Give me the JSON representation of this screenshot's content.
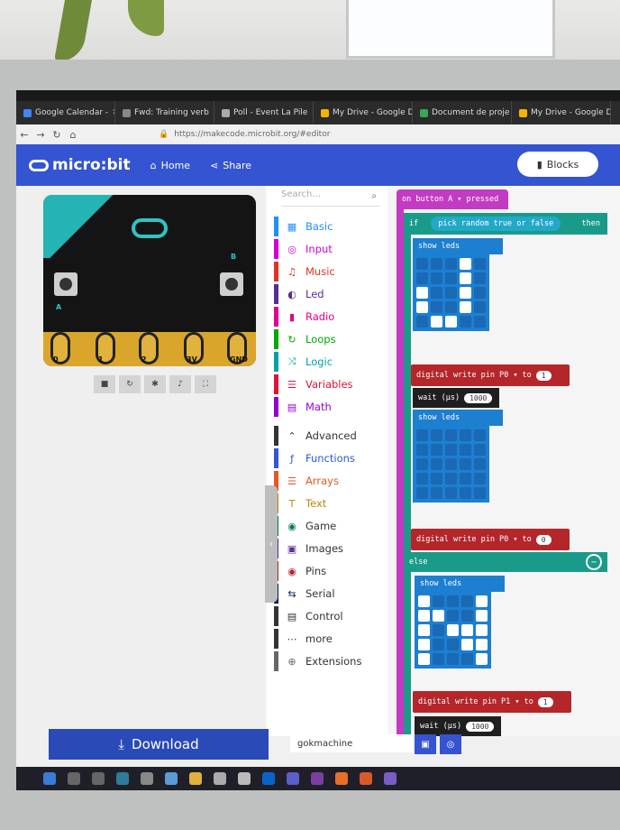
{
  "browser": {
    "tabs": [
      {
        "label": "Google Calendar - ",
        "icon": "calendar-icon",
        "color": "#4285f4"
      },
      {
        "label": "Fwd: Training verb",
        "icon": "mail-icon",
        "color": "#888888"
      },
      {
        "label": "Poll - Event La Pile",
        "icon": "poll-icon",
        "color": "#aaaaaa"
      },
      {
        "label": "My Drive - Google D",
        "icon": "drive-icon",
        "color": "#f4b400"
      },
      {
        "label": "Document de proje",
        "icon": "doc-icon",
        "color": "#34a853"
      },
      {
        "label": "My Drive - Google D",
        "icon": "drive-icon",
        "color": "#f4b400"
      }
    ],
    "url": "https://makecode.microbit.org/#editor"
  },
  "header": {
    "logo": "micro:bit",
    "home": "Home",
    "share": "Share",
    "blocks": "Blocks"
  },
  "simulator": {
    "pins": [
      "0",
      "1",
      "2",
      "3V",
      "GND"
    ],
    "button_a": "A",
    "button_b": "B"
  },
  "toolbox": {
    "search_placeholder": "Search...",
    "categories": [
      {
        "label": "Basic",
        "color": "#1e90ff",
        "icon": "grid-icon"
      },
      {
        "label": "Input",
        "color": "#d400d4",
        "icon": "target-icon"
      },
      {
        "label": "Music",
        "color": "#e63022",
        "icon": "headphones-icon"
      },
      {
        "label": "Led",
        "color": "#5c2d91",
        "icon": "toggle-icon"
      },
      {
        "label": "Radio",
        "color": "#e3008c",
        "icon": "signal-icon"
      },
      {
        "label": "Loops",
        "color": "#00aa00",
        "icon": "loop-icon"
      },
      {
        "label": "Logic",
        "color": "#00a4a6",
        "icon": "shuffle-icon"
      },
      {
        "label": "Variables",
        "color": "#dc143c",
        "icon": "list-icon"
      },
      {
        "label": "Math",
        "color": "#9400d3",
        "icon": "calculator-icon"
      },
      {
        "label": "Advanced",
        "color": "#333333",
        "icon": "chevron-up-icon"
      },
      {
        "label": "Functions",
        "color": "#3455db",
        "icon": "function-icon"
      },
      {
        "label": "Arrays",
        "color": "#e65722",
        "icon": "array-icon"
      },
      {
        "label": "Text",
        "color": "#b8860b",
        "icon": "text-icon"
      },
      {
        "label": "Game",
        "color": "#007a4b",
        "icon": "gamepad-icon"
      },
      {
        "label": "Images",
        "color": "#5c2d91",
        "icon": "image-icon"
      },
      {
        "label": "Pins",
        "color": "#b22222",
        "icon": "pin-icon"
      },
      {
        "label": "Serial",
        "color": "#002050",
        "icon": "usb-icon"
      },
      {
        "label": "Control",
        "color": "#333333",
        "icon": "control-icon"
      },
      {
        "label": "more",
        "color": "#333333",
        "icon": "more-icon"
      },
      {
        "label": "Extensions",
        "color": "#666666",
        "icon": "plus-icon"
      }
    ]
  },
  "workspace": {
    "event": {
      "label": "on button",
      "button": "A",
      "suffix": "pressed"
    },
    "if_label": "if",
    "condition": "pick random true or false",
    "then_label": "then",
    "else_label": "else",
    "show_leds": "show leds",
    "digital_write": "digital write pin",
    "to_label": "to",
    "wait_label": "wait (µs)",
    "wait_value": "1000",
    "write1": {
      "pin": "P0",
      "value": "1"
    },
    "write2": {
      "pin": "P0",
      "value": "0"
    },
    "write3": {
      "pin": "P1",
      "value": "1"
    },
    "leds_v": [
      0,
      0,
      0,
      1,
      0,
      0,
      0,
      0,
      1,
      0,
      1,
      0,
      0,
      1,
      0,
      1,
      0,
      0,
      1,
      0,
      0,
      1,
      1,
      0,
      0
    ],
    "leds_blank": [
      0,
      0,
      0,
      0,
      0,
      0,
      0,
      0,
      0,
      0,
      0,
      0,
      0,
      0,
      0,
      0,
      0,
      0,
      0,
      0,
      0,
      0,
      0,
      0,
      0
    ],
    "leds_n": [
      1,
      0,
      0,
      0,
      1,
      1,
      1,
      0,
      0,
      1,
      1,
      0,
      1,
      1,
      1,
      1,
      0,
      0,
      1,
      1,
      1,
      0,
      0,
      0,
      1
    ]
  },
  "footer": {
    "download": "Download",
    "project_name": "gokmachine"
  }
}
